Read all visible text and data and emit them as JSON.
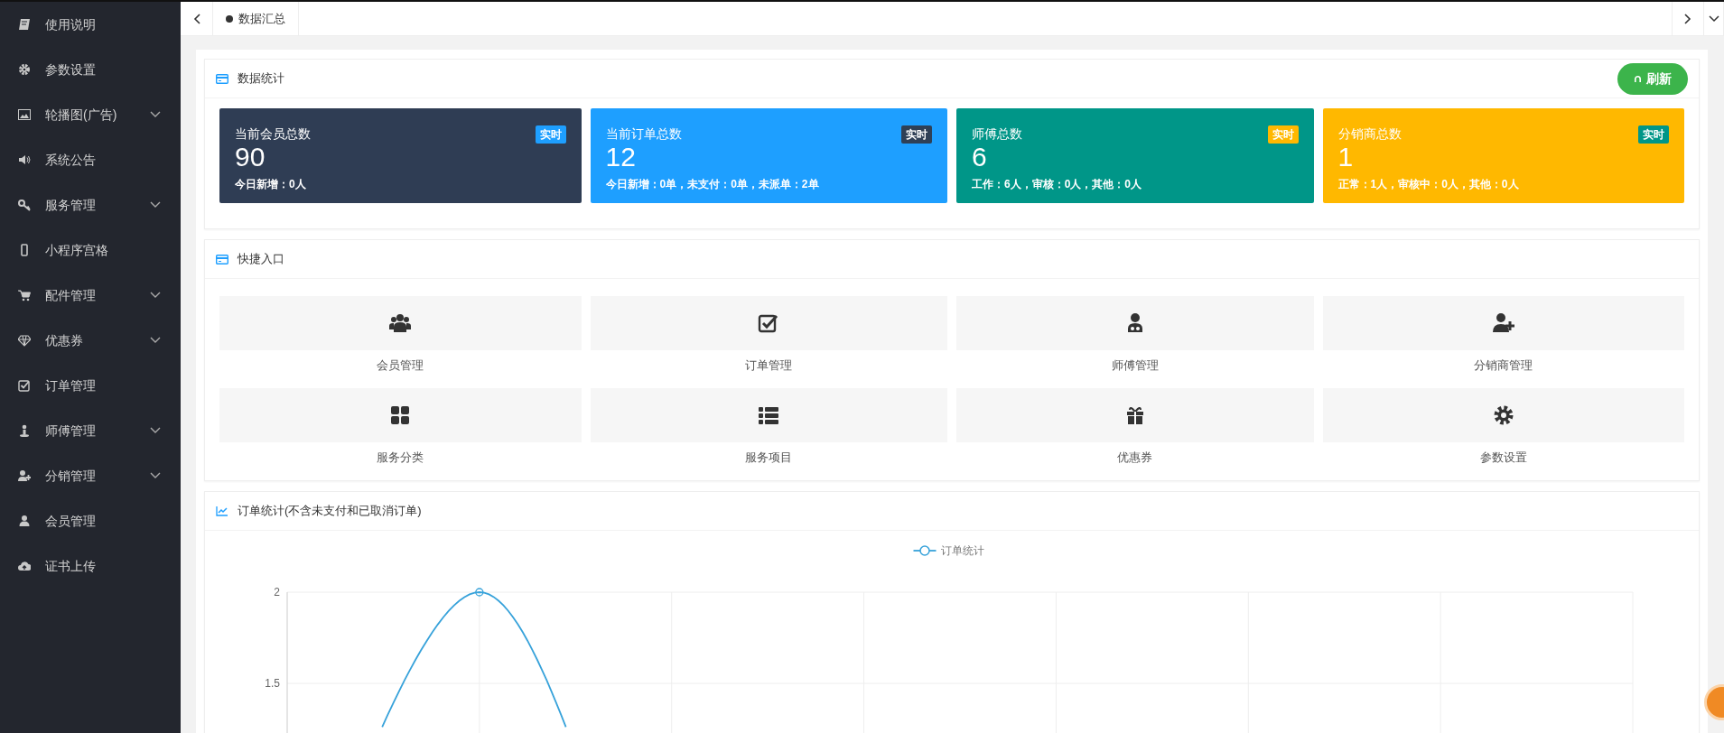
{
  "sidebar": {
    "items": [
      {
        "label": "使用说明",
        "kind": "link"
      },
      {
        "label": "参数设置",
        "kind": "link"
      },
      {
        "label": "轮播图(广告)",
        "kind": "group"
      },
      {
        "label": "系统公告",
        "kind": "link"
      },
      {
        "label": "服务管理",
        "kind": "group"
      },
      {
        "label": "小程序宫格",
        "kind": "link"
      },
      {
        "label": "配件管理",
        "kind": "group"
      },
      {
        "label": "优惠券",
        "kind": "group"
      },
      {
        "label": "订单管理",
        "kind": "link"
      },
      {
        "label": "师傅管理",
        "kind": "group"
      },
      {
        "label": "分销管理",
        "kind": "group"
      },
      {
        "label": "会员管理",
        "kind": "link"
      },
      {
        "label": "证书上传",
        "kind": "link"
      }
    ]
  },
  "tabs": [
    {
      "label": "数据汇总",
      "selected": true
    }
  ],
  "stats_panel": {
    "title": "数据统计",
    "refresh_button": "刷新",
    "cards": [
      {
        "title": "当前会员总数",
        "value": "90",
        "detail": "今日新增：0人",
        "color": "#2f3d54",
        "badge": {
          "label": "实时",
          "color": "#1e9fff"
        }
      },
      {
        "title": "当前订单总数",
        "value": "12",
        "detail": "今日新增：0单，未支付：0单，未派单：2单",
        "color": "#1e9fff",
        "badge": {
          "label": "实时",
          "color": "#2f4056"
        }
      },
      {
        "title": "师傅总数",
        "value": "6",
        "detail": "工作：6人，审核：0人，其他：0人",
        "color": "#009688",
        "badge": {
          "label": "实时",
          "color": "#ffb800"
        }
      },
      {
        "title": "分销商总数",
        "value": "1",
        "detail": "正常：1人，审核中：0人，其他：0人",
        "color": "#ffb800",
        "badge": {
          "label": "实时",
          "color": "#009688"
        }
      }
    ]
  },
  "shortcuts_panel": {
    "title": "快捷入口",
    "items": [
      {
        "label": "会员管理"
      },
      {
        "label": "订单管理"
      },
      {
        "label": "师傅管理"
      },
      {
        "label": "分销商管理"
      },
      {
        "label": "服务分类"
      },
      {
        "label": "服务项目"
      },
      {
        "label": "优惠券"
      },
      {
        "label": "参数设置"
      }
    ]
  },
  "chart_panel": {
    "title": "订单统计(不含未支付和已取消订单)",
    "legend": "订单统计",
    "y_axis_labels": [
      "2",
      "1.5"
    ]
  }
}
